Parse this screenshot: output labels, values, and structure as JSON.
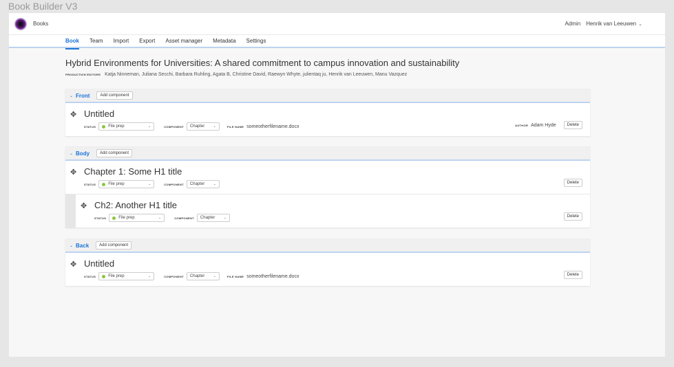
{
  "frame_title": "Book Builder V3",
  "header": {
    "brand": "Books",
    "admin": "Admin",
    "user": "Henrik van Leeuwen"
  },
  "tabs": [
    {
      "label": "Book",
      "active": true
    },
    {
      "label": "Team"
    },
    {
      "label": "Import"
    },
    {
      "label": "Export"
    },
    {
      "label": "Asset manager"
    },
    {
      "label": "Metadata"
    },
    {
      "label": "Settings"
    }
  ],
  "book": {
    "title": "Hybrid Environments for Universities: A shared commitment to campus innovation and sustainability",
    "editors_label": "Production editors",
    "editors": "Katja Ninneman, Juliana Secchi, Barbara Ruhling, Agata B, Christine David, Raewyn Whyte, julientaq ju, Henrik van Leeuwen, Manu Vazquez"
  },
  "labels": {
    "add_component": "Add component",
    "status": "Status",
    "component": "Component",
    "file_name": "File name",
    "author": "Author",
    "delete": "Delete"
  },
  "sections": {
    "front": {
      "name": "Front",
      "items": [
        {
          "title": "Untitled",
          "status": "File prep",
          "component": "Chapter",
          "file_name": "someotherfilename.docx",
          "author": "Adam Hyde"
        }
      ]
    },
    "body": {
      "name": "Body",
      "items": [
        {
          "title": "Chapter 1: Some H1 title",
          "status": "File prep",
          "component": "Chapter"
        },
        {
          "title": "Ch2: Another H1 title",
          "status": "File prep",
          "component": "Chapter"
        }
      ]
    },
    "back": {
      "name": "Back",
      "items": [
        {
          "title": "Untitled",
          "status": "File prep",
          "component": "Chapter",
          "file_name": "someotherfilename.docx"
        }
      ]
    }
  },
  "colors": {
    "accent": "#1a73d8",
    "status_dot": "#8cc63f"
  }
}
